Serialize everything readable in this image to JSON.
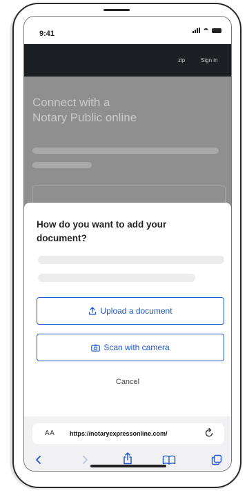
{
  "status_bar": {
    "time": "9:41"
  },
  "navbar": {
    "links": [
      "zip",
      "Sign in"
    ]
  },
  "background_page": {
    "hero_line1": "Connect with a",
    "hero_line2": "Notary Public online"
  },
  "sheet": {
    "title": "How do you want to add your document?",
    "upload_label": "Upload a document",
    "scan_label": "Scan with camera",
    "cancel_label": "Cancel"
  },
  "browser": {
    "text_size_label": "AA",
    "url": "https://notaryexpressonline.com/",
    "toolbar_icons": [
      "back-icon",
      "forward-icon",
      "share-icon",
      "bookmarks-icon",
      "tabs-icon"
    ]
  },
  "colors": {
    "accent": "#1d57c9",
    "navbar": "#1c1f24"
  }
}
